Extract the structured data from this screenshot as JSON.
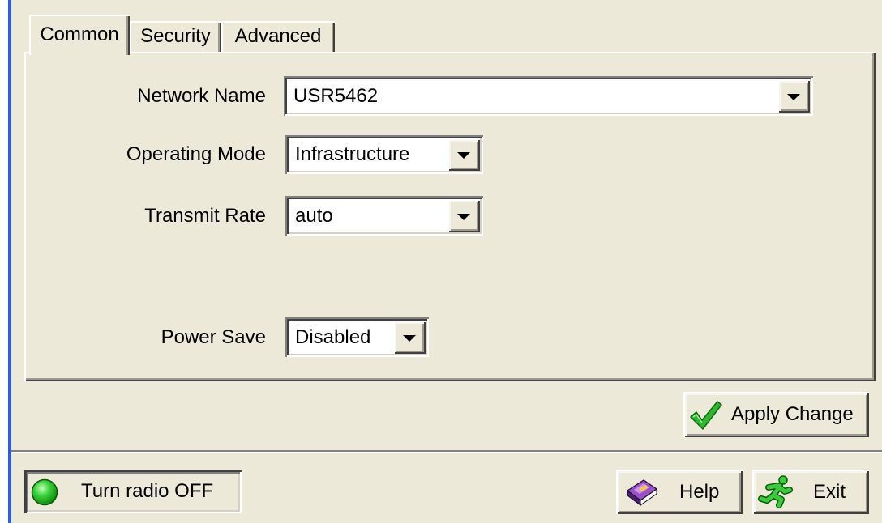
{
  "tabs": [
    {
      "label": "Common",
      "selected": true
    },
    {
      "label": "Security",
      "selected": false
    },
    {
      "label": "Advanced",
      "selected": false
    }
  ],
  "fields": {
    "network_name": {
      "label": "Network Name",
      "value": "USR5462"
    },
    "operating_mode": {
      "label": "Operating Mode",
      "value": "Infrastructure"
    },
    "transmit_rate": {
      "label": "Transmit Rate",
      "value": "auto"
    },
    "power_save": {
      "label": "Power Save",
      "value": "Disabled"
    }
  },
  "buttons": {
    "apply": {
      "label": "Apply Change",
      "icon": "checkmark-icon"
    },
    "radio_toggle": {
      "label": "Turn radio OFF",
      "icon": "radio-status-led-icon"
    },
    "help": {
      "label": "Help",
      "icon": "book-icon"
    },
    "exit": {
      "label": "Exit",
      "icon": "running-man-icon"
    }
  },
  "icons": {
    "dropdown": "dropdown-arrow-icon"
  },
  "colors": {
    "window_background": "#ECE9D8",
    "window_accent": "#2D5FD6",
    "led_green": "#3CD43C",
    "checkmark_green": "#2FB82F",
    "exit_icon_green": "#3CCB3C",
    "help_book_purple": "#9B4FC8"
  }
}
